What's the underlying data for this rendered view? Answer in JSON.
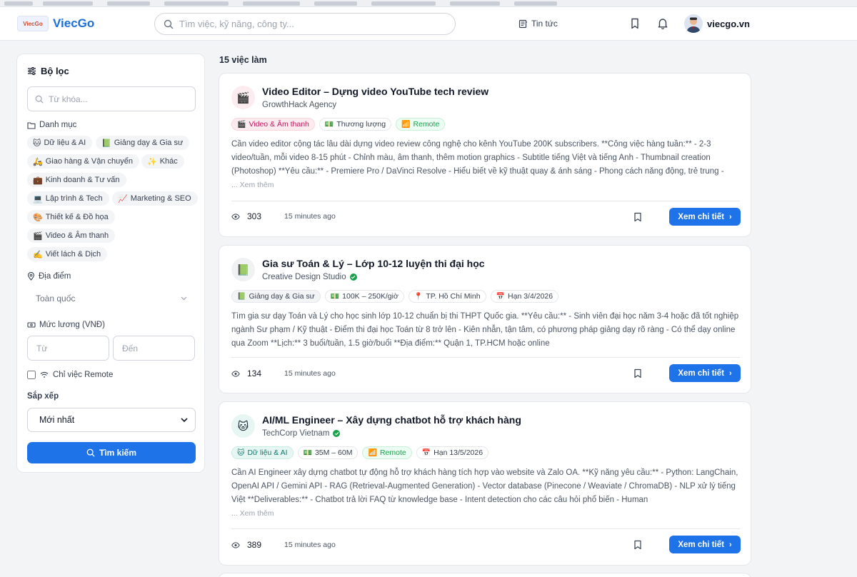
{
  "header": {
    "logo_badge": "ViecGo",
    "logo_text": "ViecGo",
    "search_placeholder": "Tìm việc, kỹ năng, công ty...",
    "news_label": "Tin tức",
    "username": "viecgo.vn"
  },
  "sidebar": {
    "title": "Bộ lọc",
    "keyword_placeholder": "Từ khóa...",
    "category_label": "Danh mục",
    "categories": [
      {
        "icon": "🐱",
        "label": "Dữ liệu & AI"
      },
      {
        "icon": "📗",
        "label": "Giảng dạy & Gia sư"
      },
      {
        "icon": "🛵",
        "label": "Giao hàng & Vận chuyển"
      },
      {
        "icon": "✨",
        "label": "Khác"
      },
      {
        "icon": "💼",
        "label": "Kinh doanh & Tư vấn"
      },
      {
        "icon": "💻",
        "label": "Lập trình & Tech"
      },
      {
        "icon": "📈",
        "label": "Marketing & SEO"
      },
      {
        "icon": "🎨",
        "label": "Thiết kế & Đồ họa"
      },
      {
        "icon": "🎬",
        "label": "Video & Âm thanh"
      },
      {
        "icon": "✍️",
        "label": "Viết lách & Dịch"
      }
    ],
    "location_label": "Địa điểm",
    "location_value": "Toàn quốc",
    "salary_label": "Mức lương (VNĐ)",
    "salary_from_placeholder": "Từ",
    "salary_to_placeholder": "Đến",
    "remote_label": "Chỉ việc Remote",
    "sort_label": "Sắp xếp",
    "sort_value": "Mới nhất",
    "search_button": "Tìm kiếm"
  },
  "main": {
    "count": "15 việc làm",
    "jobs": [
      {
        "icon": "🎬",
        "title": "Video Editor – Dựng video YouTube tech review",
        "company": "GrowthHack Agency",
        "tags": [
          {
            "icon": "🎬",
            "label": "Video & Âm thanh"
          },
          {
            "icon": "💵",
            "label": "Thương lượng"
          },
          {
            "icon": "📶",
            "label": "Remote"
          }
        ],
        "description": "Cần video editor cộng tác lâu dài dựng video review công nghệ cho kênh YouTube 200K subscribers. **Công việc hàng tuần:** - 2-3 video/tuần, mỗi video 8-15 phút - Chỉnh màu, âm thanh, thêm motion graphics - Subtitle tiếng Việt và tiếng Anh - Thumbnail creation (Photoshop) **Yêu cầu:** - Premiere Pro / DaVinci Resolve - Hiểu biết về kỹ thuật quay & ánh sáng - Phong cách năng động, trẻ trung -",
        "more": "... Xem thêm",
        "views": "303",
        "time": "15 minutes ago",
        "detail_button": "Xem chi tiết"
      },
      {
        "icon": "📗",
        "title": "Gia sư Toán & Lý – Lớp 10-12 luyện thi đại học",
        "company": "Creative Design Studio",
        "tags": [
          {
            "icon": "📗",
            "label": "Giảng dạy & Gia sư"
          },
          {
            "icon": "💵",
            "label": "100K – 250K/giờ"
          },
          {
            "icon": "📍",
            "label": "TP. Hồ Chí Minh"
          },
          {
            "icon": "📅",
            "label": "Hạn 3/4/2026"
          }
        ],
        "description": "Tìm gia sư dạy Toán và Lý cho học sinh lớp 10-12 chuẩn bị thi THPT Quốc gia. **Yêu cầu:** - Sinh viên đại học năm 3-4 hoặc đã tốt nghiệp ngành Sư phạm / Kỹ thuật - Điểm thi đại học Toán từ 8 trở lên - Kiên nhẫn, tận tâm, có phương pháp giảng dạy rõ ràng - Có thể dạy online qua Zoom **Lịch:** 3 buổi/tuần, 1.5 giờ/buổi **Địa điểm:** Quận 1, TP.HCM hoặc online",
        "views": "134",
        "time": "15 minutes ago",
        "detail_button": "Xem chi tiết"
      },
      {
        "icon": "🐱",
        "title": "AI/ML Engineer – Xây dựng chatbot hỗ trợ khách hàng",
        "company": "TechCorp Vietnam",
        "tags": [
          {
            "icon": "🐱",
            "label": "Dữ liệu & AI"
          },
          {
            "icon": "💵",
            "label": "35M – 60M"
          },
          {
            "icon": "📶",
            "label": "Remote"
          },
          {
            "icon": "📅",
            "label": "Hạn 13/5/2026"
          }
        ],
        "description": "Cần AI Engineer xây dựng chatbot tự động hỗ trợ khách hàng tích hợp vào website và Zalo OA. **Kỹ năng yêu cầu:** - Python: LangChain, OpenAI API / Gemini API - RAG (Retrieval-Augmented Generation) - Vector database (Pinecone / Weaviate / ChromaDB) - NLP xử lý tiếng Việt **Deliverables:** - Chatbot trả lời FAQ từ knowledge base - Intent detection cho các câu hỏi phổ biến - Human",
        "more": "... Xem thêm",
        "views": "389",
        "time": "15 minutes ago",
        "detail_button": "Xem chi tiết"
      }
    ]
  },
  "colors": {
    "primary": "#1e73e8",
    "remote_green": "#16a34a",
    "video_pink": "#be185d"
  }
}
